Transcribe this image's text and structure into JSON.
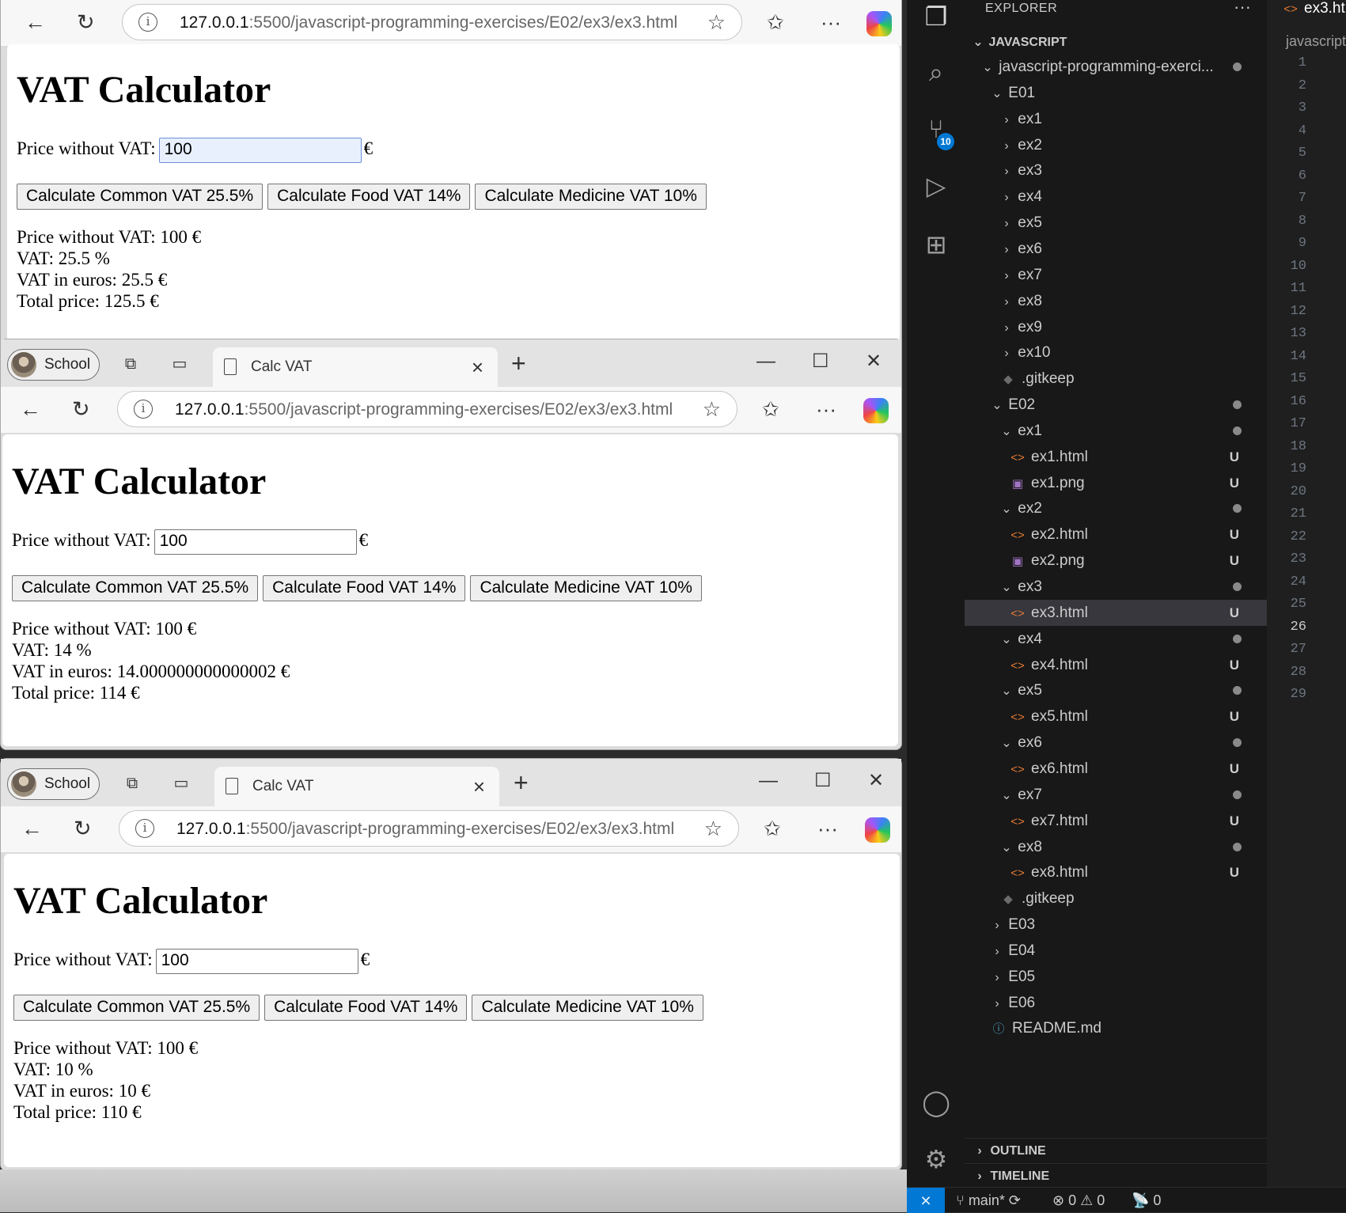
{
  "browser": {
    "profile_label": "School",
    "tab_title": "Calc VAT",
    "url_host": "127.0.0.1",
    "url_rest": ":5500/javascript-programming-exercises/E02/ex3/ex3.html",
    "window_controls": {
      "minimize": "—",
      "maximize": "☐",
      "close": "✕"
    }
  },
  "windows": [
    {
      "heading": "VAT Calculator",
      "price_label": "Price without VAT:",
      "price_value": "100",
      "currency": "€",
      "buttons": [
        "Calculate Common VAT 25.5%",
        "Calculate Food VAT 14%",
        "Calculate Medicine VAT 10%"
      ],
      "results": [
        "Price without VAT: 100 €",
        "VAT: 25.5 %",
        "VAT in euros: 25.5 €",
        "Total price: 125.5 €"
      ]
    },
    {
      "heading": "VAT Calculator",
      "price_label": "Price without VAT:",
      "price_value": "100",
      "currency": "€",
      "buttons": [
        "Calculate Common VAT 25.5%",
        "Calculate Food VAT 14%",
        "Calculate Medicine VAT 10%"
      ],
      "results": [
        "Price without VAT: 100 €",
        "VAT: 14 %",
        "VAT in euros: 14.000000000000002 €",
        "Total price: 114 €"
      ]
    },
    {
      "heading": "VAT Calculator",
      "price_label": "Price without VAT:",
      "price_value": "100",
      "currency": "€",
      "buttons": [
        "Calculate Common VAT 25.5%",
        "Calculate Food VAT 14%",
        "Calculate Medicine VAT 10%"
      ],
      "results": [
        "Price without VAT: 100 €",
        "VAT: 10 %",
        "VAT in euros: 10 €",
        "Total price: 110 €"
      ]
    }
  ],
  "vscode": {
    "explorer_title": "EXPLORER",
    "explorer_more": "···",
    "root": "JAVASCRIPT",
    "tree": [
      {
        "label": "javascript-programming-exerci...",
        "type": "folder",
        "open": true,
        "dot": true
      },
      {
        "label": "E01",
        "type": "folder",
        "open": true
      },
      {
        "label": "ex1",
        "type": "folder"
      },
      {
        "label": "ex2",
        "type": "folder"
      },
      {
        "label": "ex3",
        "type": "folder"
      },
      {
        "label": "ex4",
        "type": "folder"
      },
      {
        "label": "ex5",
        "type": "folder"
      },
      {
        "label": "ex6",
        "type": "folder"
      },
      {
        "label": "ex7",
        "type": "folder"
      },
      {
        "label": "ex8",
        "type": "folder"
      },
      {
        "label": "ex9",
        "type": "folder"
      },
      {
        "label": "ex10",
        "type": "folder"
      },
      {
        "label": ".gitkeep",
        "type": "git"
      },
      {
        "label": "E02",
        "type": "folder",
        "open": true,
        "dot": true
      },
      {
        "label": "ex1",
        "type": "folder",
        "open": true,
        "dot": true
      },
      {
        "label": "ex1.html",
        "type": "html",
        "status": "U"
      },
      {
        "label": "ex1.png",
        "type": "png",
        "status": "U"
      },
      {
        "label": "ex2",
        "type": "folder",
        "open": true,
        "dot": true
      },
      {
        "label": "ex2.html",
        "type": "html",
        "status": "U"
      },
      {
        "label": "ex2.png",
        "type": "png",
        "status": "U"
      },
      {
        "label": "ex3",
        "type": "folder",
        "open": true,
        "dot": true
      },
      {
        "label": "ex3.html",
        "type": "html",
        "status": "U",
        "selected": true
      },
      {
        "label": "ex4",
        "type": "folder",
        "open": true,
        "dot": true
      },
      {
        "label": "ex4.html",
        "type": "html",
        "status": "U"
      },
      {
        "label": "ex5",
        "type": "folder",
        "open": true,
        "dot": true
      },
      {
        "label": "ex5.html",
        "type": "html",
        "status": "U"
      },
      {
        "label": "ex6",
        "type": "folder",
        "open": true,
        "dot": true
      },
      {
        "label": "ex6.html",
        "type": "html",
        "status": "U"
      },
      {
        "label": "ex7",
        "type": "folder",
        "open": true,
        "dot": true
      },
      {
        "label": "ex7.html",
        "type": "html",
        "status": "U"
      },
      {
        "label": "ex8",
        "type": "folder",
        "open": true,
        "dot": true
      },
      {
        "label": "ex8.html",
        "type": "html",
        "status": "U"
      },
      {
        "label": ".gitkeep",
        "type": "git"
      },
      {
        "label": "E03",
        "type": "folder"
      },
      {
        "label": "E04",
        "type": "folder"
      },
      {
        "label": "E05",
        "type": "folder"
      },
      {
        "label": "E06",
        "type": "folder"
      },
      {
        "label": "README.md",
        "type": "info"
      }
    ],
    "outline": "OUTLINE",
    "timeline": "TIMELINE",
    "source_control_badge": "10",
    "editor_tab": "ex3.ht",
    "breadcrumb": "javascript",
    "line_numbers": [
      "1",
      "2",
      "3",
      "4",
      "5",
      "6",
      "7",
      "8",
      "9",
      "10",
      "11",
      "12",
      "13",
      "14",
      "15",
      "16",
      "17",
      "18",
      "19",
      "20",
      "21",
      "22",
      "23",
      "24",
      "25",
      "26",
      "27",
      "28",
      "29"
    ],
    "current_line": "26",
    "status": {
      "branch": "main*",
      "errors": "0",
      "warnings": "0",
      "ports": "0"
    }
  }
}
